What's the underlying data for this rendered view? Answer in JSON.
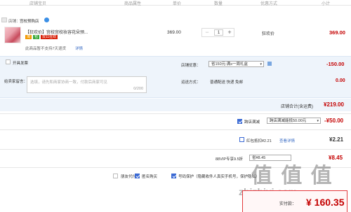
{
  "header": {
    "col_store": "店铺宝贝",
    "col_props": "商品属性",
    "col_price": "单价",
    "col_qty": "数量",
    "col_promo": "优惠方式",
    "col_subtotal": "小计"
  },
  "store": {
    "label": "店铺：",
    "name": "宫校预购店"
  },
  "item": {
    "title": "【狂欢价】宫校宫校妆容花朵预...",
    "badge1": "淘",
    "badge2": "包",
    "badge3": "双11狂欢",
    "notice": "此商品暂不支持7天退货",
    "notice_link": "详情",
    "unit_price": "369.00",
    "qty": "1",
    "promo": "狂欢价",
    "subtotal": "369.00"
  },
  "panel": {
    "invoice_label": "开具发票",
    "message_label": "给卖家留言：",
    "message_placeholder": "选填，请先和商家协商一致，付款后商家可见",
    "char_count": "0/200",
    "shop_discount_label": "店铺优惠：",
    "shop_discount_value": "省150元:满s一周礼盒",
    "shop_discount_amount": "-150.00",
    "shipping_label": "运送方式：",
    "shipping_value": "普通配送 快递 免邮",
    "shipping_amount": "0.00"
  },
  "store_total": {
    "label": "店铺合计(含运费)",
    "amount": "¥219.00"
  },
  "cross_store": {
    "label": "跨店满减",
    "value": "跨店满减能抵50.00元",
    "amount": "-¥50.00"
  },
  "redpacket": {
    "label": "红包抵扣¥2.21",
    "link": "查看详情",
    "amount": "¥2.21"
  },
  "vip": {
    "label": "88VIP专享9.5折",
    "value": "省¥8.45",
    "amount": "¥8.45"
  },
  "options": {
    "friend_pay": "朋友代付",
    "anonymous": "匿名购买",
    "privacy": "号码保护（隐藏收件人真实手机号，保护隐私）"
  },
  "footer": {
    "actual_label": "实付款：",
    "actual_amount": "¥ 160.35",
    "watermark_top": "值 值 值",
    "watermark_bottom": "zhizhiyi.com"
  },
  "colors": {
    "accent_red": "#c40000",
    "panel_blue": "#eef4fb",
    "check_blue": "#3b6ad4"
  }
}
